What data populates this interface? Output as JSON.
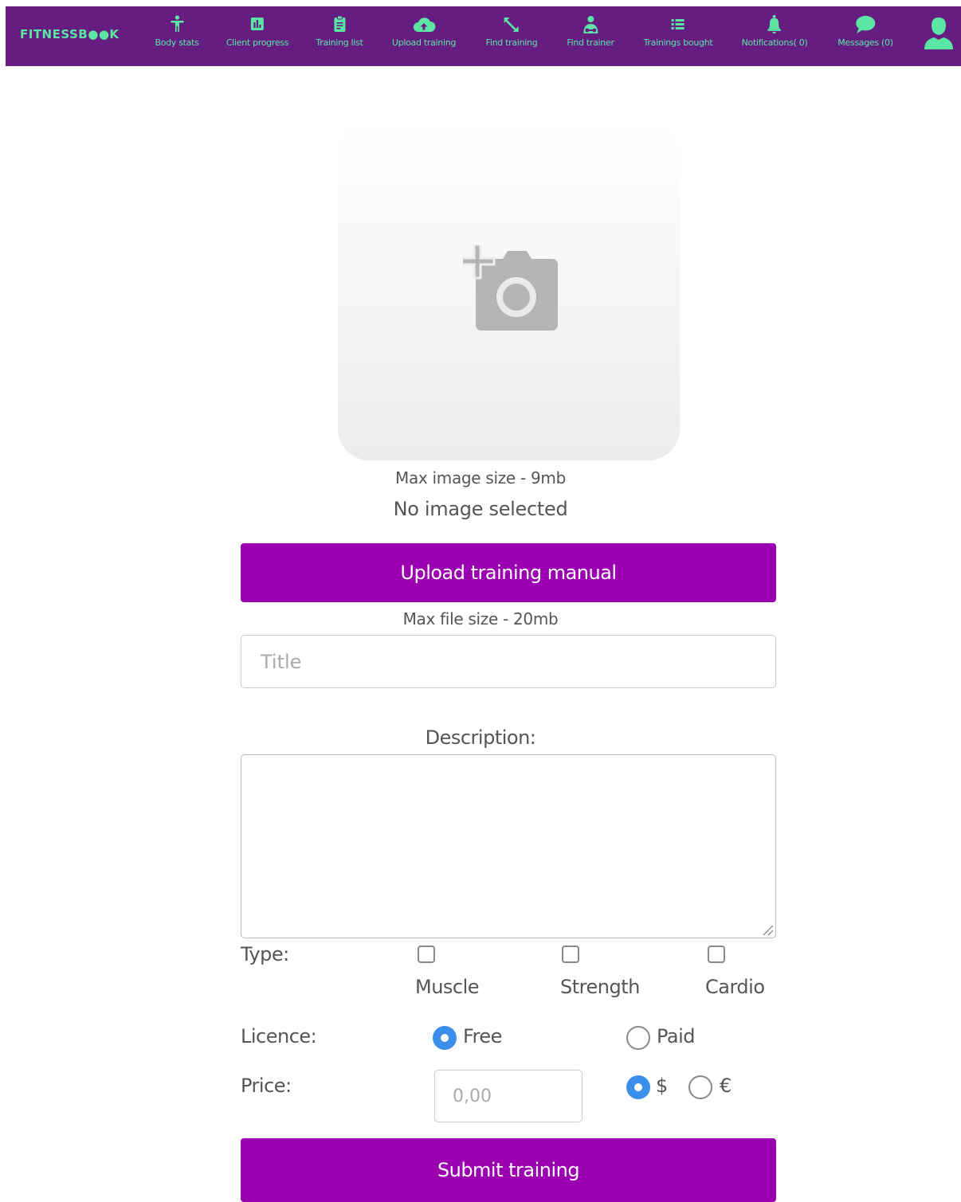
{
  "nav": {
    "brand": "FITNESSB●●K",
    "items": [
      {
        "label": "Body stats",
        "icon": "person-icon"
      },
      {
        "label": "Client progress",
        "icon": "bar-chart-icon"
      },
      {
        "label": "Training list",
        "icon": "clipboard-icon"
      },
      {
        "label": "Upload training",
        "icon": "cloud-upload-icon"
      },
      {
        "label": "Find training",
        "icon": "resize-arrows-icon"
      },
      {
        "label": "Find trainer",
        "icon": "trainer-icon"
      },
      {
        "label": "Trainings bought",
        "icon": "list-icon"
      },
      {
        "label": "Notifications( 0)",
        "icon": "bell-icon"
      },
      {
        "label": "Messages (0)",
        "icon": "chat-bubble-icon"
      }
    ],
    "avatar_icon": "user-avatar-icon"
  },
  "upload": {
    "image_icon": "add-photo-camera-icon",
    "max_image_size": "Max image size - 9mb",
    "no_image": "No image selected",
    "upload_manual_label": "Upload training manual",
    "max_file_size": "Max file size - 20mb"
  },
  "form": {
    "title_placeholder": "Title",
    "description_label": "Description:",
    "type_label": "Type:",
    "types": [
      "Muscle",
      "Strength",
      "Cardio"
    ],
    "licence_label": "Licence:",
    "licence_options": [
      "Free",
      "Paid"
    ],
    "licence_selected": "Free",
    "price_label": "Price:",
    "price_placeholder": "0,00",
    "currencies": [
      "$",
      "€"
    ],
    "currency_selected": "$",
    "submit_label": "Submit training"
  },
  "colors": {
    "nav_bg": "#651d82",
    "nav_accent": "#5be6a3",
    "button_bg": "#9a00b0",
    "radio_selected": "#3b8eea"
  }
}
